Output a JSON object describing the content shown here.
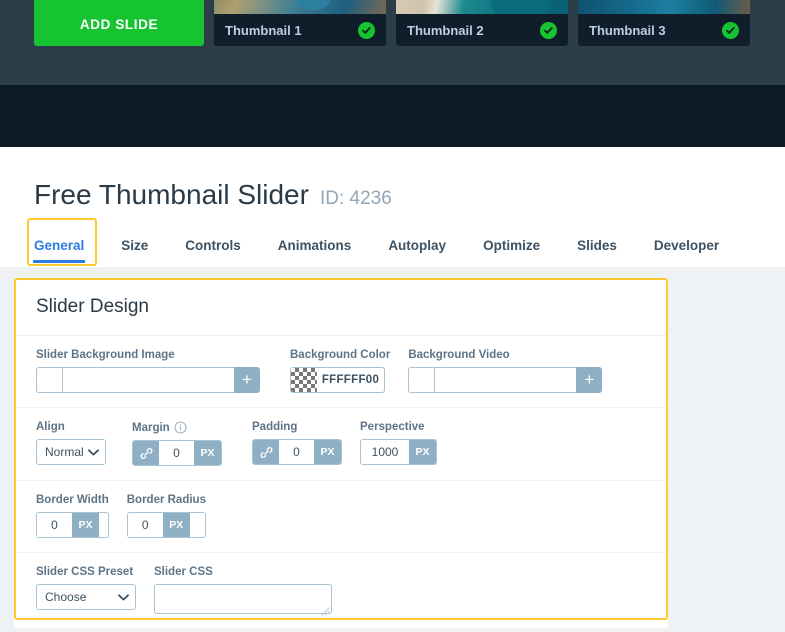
{
  "slides_strip": {
    "add_slide": {
      "label": "ADD SLIDE",
      "icon": "plus-circle-icon"
    },
    "cards": [
      {
        "title": "Thumbnail 1",
        "status_icon": "check-circle-icon"
      },
      {
        "title": "Thumbnail 2",
        "status_icon": "check-circle-icon"
      },
      {
        "title": "Thumbnail 3",
        "status_icon": "check-circle-icon"
      }
    ]
  },
  "page": {
    "title": "Free Thumbnail Slider",
    "id_label": "ID: 4236"
  },
  "tabs": [
    {
      "label": "General",
      "active": true
    },
    {
      "label": "Size",
      "active": false
    },
    {
      "label": "Controls",
      "active": false
    },
    {
      "label": "Animations",
      "active": false
    },
    {
      "label": "Autoplay",
      "active": false
    },
    {
      "label": "Optimize",
      "active": false
    },
    {
      "label": "Slides",
      "active": false
    },
    {
      "label": "Developer",
      "active": false
    }
  ],
  "panel": {
    "heading": "Slider Design",
    "fields": {
      "slider_background_image": {
        "label": "Slider Background Image",
        "value": "",
        "add_icon": "plus-icon"
      },
      "background_color": {
        "label": "Background Color",
        "value": "FFFFFF00",
        "swatch_icon": "transparent-checker-icon"
      },
      "background_video": {
        "label": "Background Video",
        "value": "",
        "add_icon": "plus-icon"
      },
      "align": {
        "label": "Align",
        "value": "Normal",
        "chevron_icon": "chevron-down-icon"
      },
      "margin": {
        "label": "Margin",
        "info_icon": "info-circle-icon",
        "link_icon": "link-chain-icon",
        "value": "0",
        "unit": "PX"
      },
      "padding": {
        "label": "Padding",
        "link_icon": "link-chain-icon",
        "value": "0",
        "unit": "PX"
      },
      "perspective": {
        "label": "Perspective",
        "value": "1000",
        "unit": "PX"
      },
      "border_width": {
        "label": "Border Width",
        "value": "0",
        "unit": "PX"
      },
      "border_radius": {
        "label": "Border Radius",
        "value": "0",
        "unit": "PX"
      },
      "slider_css_preset": {
        "label": "Slider CSS Preset",
        "value": "Choose",
        "chevron_icon": "chevron-down-icon"
      },
      "slider_css": {
        "label": "Slider CSS",
        "value": "",
        "resize_icon": "resize-grip-icon"
      }
    }
  },
  "colors": {
    "accent_blue": "#2b7de0",
    "highlight_yellow": "#ffc82c",
    "green": "#16c432",
    "dark_band": "#0c1c27",
    "slate_band": "#2c3e4a",
    "control_blue_gray": "#8fb0c4"
  }
}
